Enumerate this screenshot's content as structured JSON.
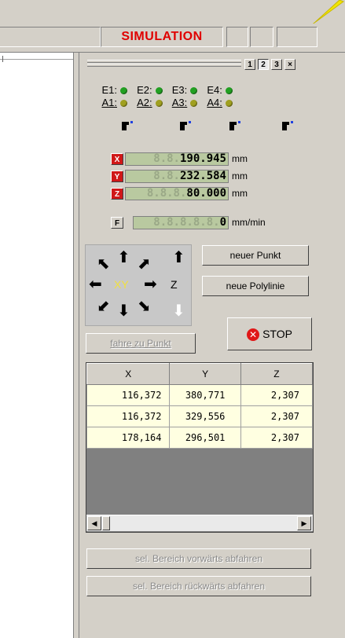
{
  "topbar": {
    "mode_label": "SIMULATION"
  },
  "panel_tabs": [
    "1",
    "2",
    "3",
    "×"
  ],
  "active_tab": "2",
  "inputs_row": [
    {
      "label": "E1:",
      "color": "#22a022"
    },
    {
      "label": "E2:",
      "color": "#22a022"
    },
    {
      "label": "E3:",
      "color": "#22a022"
    },
    {
      "label": "E4:",
      "color": "#22a022"
    }
  ],
  "outputs_row": [
    {
      "label": "A1:",
      "color": "#a0a020"
    },
    {
      "label": "A2:",
      "color": "#a0a020"
    },
    {
      "label": "A3:",
      "color": "#a0a020"
    },
    {
      "label": "A4:",
      "color": "#a0a020"
    }
  ],
  "axes": [
    {
      "button": "X",
      "dim": "8.8.",
      "value": "190.945",
      "unit": "mm"
    },
    {
      "button": "Y",
      "dim": "8.8.",
      "value": "232.584",
      "unit": "mm"
    },
    {
      "button": "Z",
      "dim": "8.8.8.",
      "value": "80.000",
      "unit": "mm"
    }
  ],
  "feed": {
    "button": "F",
    "dim": "8.8.8.8.8.",
    "value": "0",
    "unit": "mm/min"
  },
  "jog": {
    "center_label": "XY",
    "z_label": "Z"
  },
  "buttons": {
    "new_point": "neuer Punkt",
    "new_polyline": "neue Polylinie",
    "goto_point": "fahre zu Punkt",
    "stop": "STOP",
    "run_forward": "sel. Bereich vorwärts abfahren",
    "run_backward": "sel. Bereich rückwärts abfahren"
  },
  "table": {
    "columns": [
      "X",
      "Y",
      "Z"
    ],
    "rows": [
      [
        "116,372",
        "380,771",
        "2,307"
      ],
      [
        "116,372",
        "329,556",
        "2,307"
      ],
      [
        "178,164",
        "296,501",
        "2,307"
      ]
    ]
  },
  "colors": {
    "accent_red": "#e00000",
    "axis_button_red": "#d01818",
    "led_green": "#22a022",
    "led_yellow": "#a0a020",
    "annotation_arrow": "#f2e600"
  }
}
